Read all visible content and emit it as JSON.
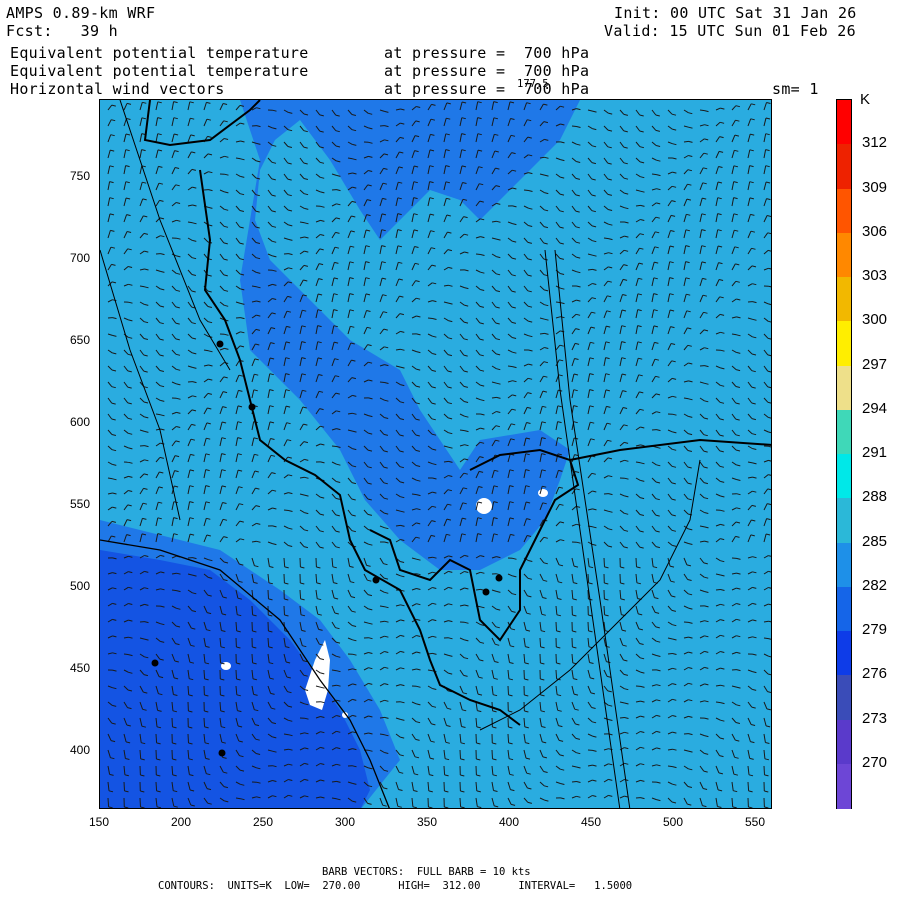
{
  "header": {
    "model": "AMPS 0.89-km WRF",
    "fcst": "Fcst:   39 h",
    "init": "Init: 00 UTC Sat 31 Jan 26",
    "valid": "Valid: 15 UTC Sun 01 Feb 26",
    "fields": [
      {
        "name": "Equivalent potential temperature",
        "level": "at pressure =  700 hPa"
      },
      {
        "name": "Equivalent potential temperature",
        "level": "at pressure =  700 hPa"
      },
      {
        "name": "Horizontal wind vectors",
        "level": "at pressure =  700 hPa"
      }
    ],
    "overlap_label": "177.5",
    "smoothing": "sm= 1"
  },
  "axes": {
    "x_ticks": [
      "150",
      "200",
      "250",
      "300",
      "350",
      "400",
      "450",
      "500",
      "550"
    ],
    "y_ticks": [
      "750",
      "700",
      "650",
      "600",
      "550",
      "500",
      "450",
      "400"
    ]
  },
  "colorbar": {
    "unit": "K",
    "labels": [
      "312",
      "309",
      "306",
      "303",
      "300",
      "297",
      "294",
      "291",
      "288",
      "285",
      "282",
      "279",
      "276",
      "273",
      "270"
    ],
    "colors": [
      "#ff0000",
      "#ee2200",
      "#ff5500",
      "#ff8800",
      "#f2b800",
      "#ffee00",
      "#eee08a",
      "#3fd8b8",
      "#00e8e8",
      "#2bb8d8",
      "#1e90e8",
      "#1565e8",
      "#0e3ce8",
      "#3a4cb8",
      "#5a3acb",
      "#6d46d6"
    ]
  },
  "footer": {
    "barbs": "BARB VECTORS:  FULL BARB = 10 kts",
    "contours": "CONTOURS:  UNITS=K  LOW=  270.00      HIGH=  312.00      INTERVAL=   1.5000"
  },
  "map_colors": {
    "warm": "#2aace0",
    "mid": "#1f8fe6",
    "cool": "#1f78e8",
    "cold": "#1454e3",
    "snow": "#ffffff"
  }
}
